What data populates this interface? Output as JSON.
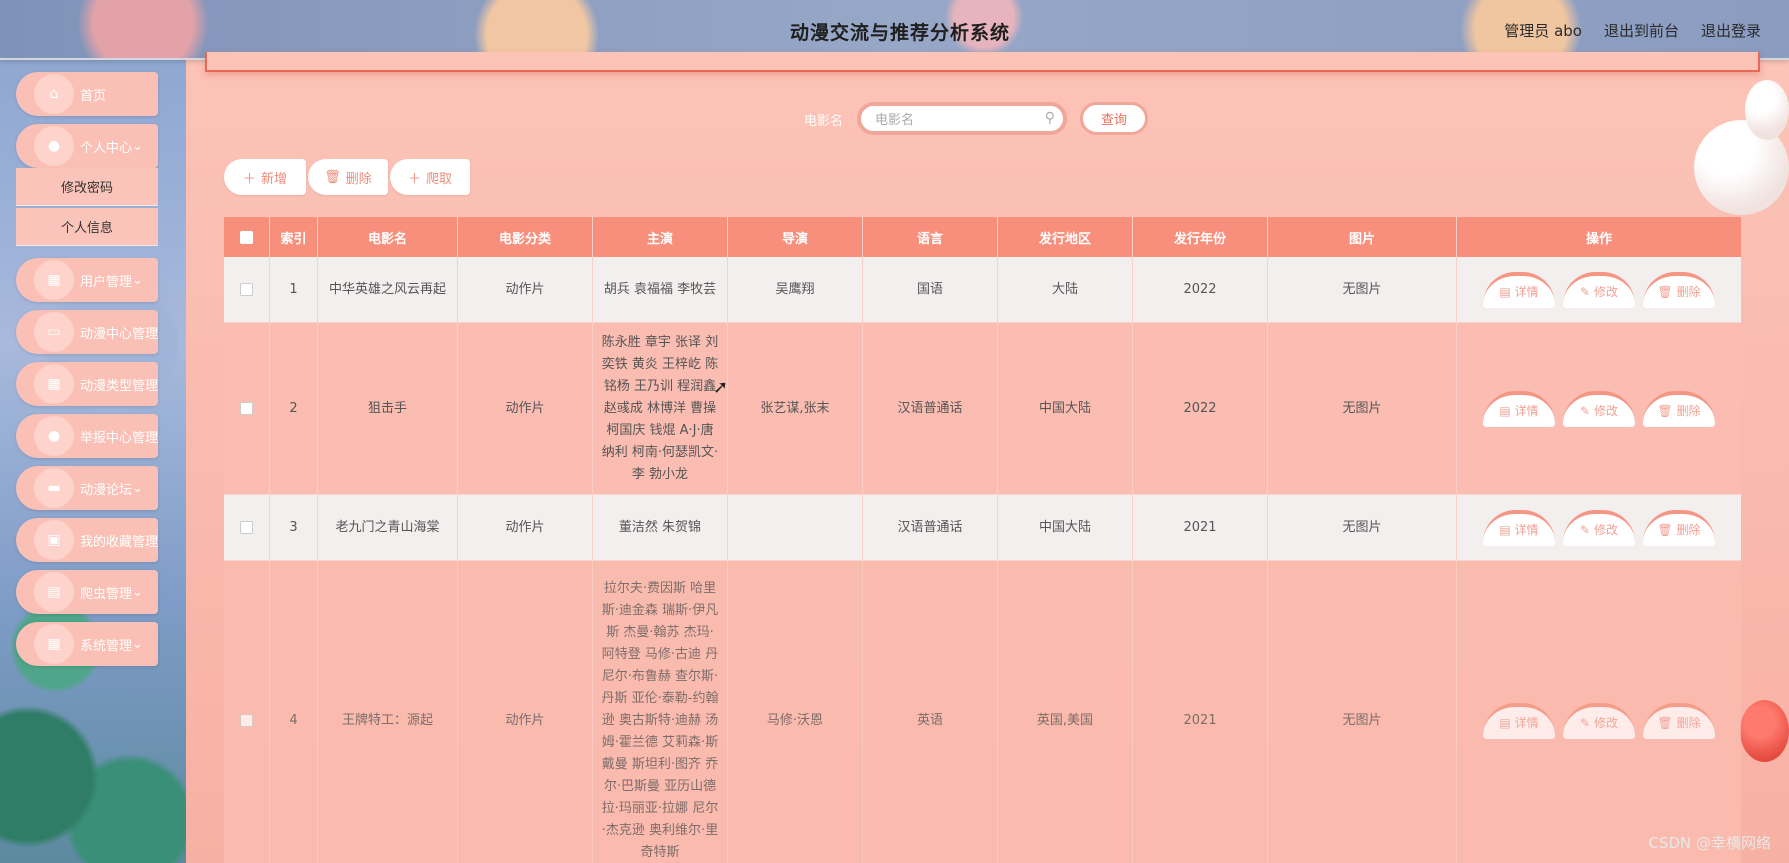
{
  "header": {
    "title": "动漫交流与推荐分析系统",
    "links": [
      "管理员 abo",
      "退出到前台",
      "退出登录"
    ]
  },
  "sidebar": {
    "items": [
      {
        "label": "首页",
        "icon": "home-icon",
        "arrow": ""
      },
      {
        "label": "个人中心",
        "icon": "user-icon",
        "arrow": "⌄"
      },
      {
        "label": "用户管理",
        "icon": "grid-icon",
        "arrow": "⌄"
      },
      {
        "label": "动漫中心管理",
        "icon": "monitor-icon",
        "arrow": ""
      },
      {
        "label": "动漫类型管理",
        "icon": "grid-icon",
        "arrow": ""
      },
      {
        "label": "举报中心管理",
        "icon": "user-icon",
        "arrow": ""
      },
      {
        "label": "动漫论坛",
        "icon": "chat-icon",
        "arrow": "⌄"
      },
      {
        "label": "我的收藏管理",
        "icon": "briefcase-icon",
        "arrow": ""
      },
      {
        "label": "爬虫管理",
        "icon": "clipboard-icon",
        "arrow": "⌄"
      },
      {
        "label": "系统管理",
        "icon": "grid-icon",
        "arrow": "⌄"
      }
    ],
    "submenu": [
      "修改密码",
      "个人信息"
    ]
  },
  "search": {
    "label": "电影名",
    "placeholder": "电影名",
    "button": "查询"
  },
  "toolbar": {
    "add": "新增",
    "delete": "删除",
    "crawl": "爬取"
  },
  "table": {
    "columns": [
      "索引",
      "电影名",
      "电影分类",
      "主演",
      "导演",
      "语言",
      "发行地区",
      "发行年份",
      "图片",
      "操作"
    ],
    "op_labels": {
      "detail": "详情",
      "edit": "修改",
      "delete": "删除"
    },
    "rows": [
      {
        "index": "1",
        "name": "中华英雄之风云再起",
        "category": "动作片",
        "cast": "胡兵 袁福福 李牧芸",
        "director": "吴鹰翔",
        "language": "国语",
        "region": "大陆",
        "year": "2022",
        "image": "无图片"
      },
      {
        "index": "2",
        "name": "狙击手",
        "category": "动作片",
        "cast": "陈永胜 章宇 张译 刘奕铁 黄炎 王梓屹 陈铭杨 王乃训 程润鑫 赵彧成 林博洋 曹操 柯国庆 钱焜 A·J·唐纳利 柯南·何瑟凯文·李 勃小龙",
        "director": "张艺谋,张末",
        "language": "汉语普通话",
        "region": "中国大陆",
        "year": "2022",
        "image": "无图片"
      },
      {
        "index": "3",
        "name": "老九门之青山海棠",
        "category": "动作片",
        "cast": "董洁然 朱贺锦",
        "director": "",
        "language": "汉语普通话",
        "region": "中国大陆",
        "year": "2021",
        "image": "无图片"
      },
      {
        "index": "4",
        "name": "王牌特工：源起",
        "category": "动作片",
        "cast": "拉尔夫·费因斯 哈里斯·迪金森 瑞斯·伊凡斯 杰曼·翰苏 杰玛·阿特登 马修·古迪 丹尼尔·布鲁赫 查尔斯·丹斯 亚伦·泰勒-约翰逊 奥古斯特·迪赫 汤姆·霍兰德 艾莉森·斯戴曼 斯坦利·图齐 乔尔·巴斯曼 亚历山德拉·玛丽亚·拉娜 尼尔·杰克逊 奥利维尔·里奇特斯",
        "director": "马修·沃恩",
        "language": "英语",
        "region": "英国,美国",
        "year": "2021",
        "image": "无图片"
      }
    ]
  },
  "watermark": "CSDN @幸横网络"
}
